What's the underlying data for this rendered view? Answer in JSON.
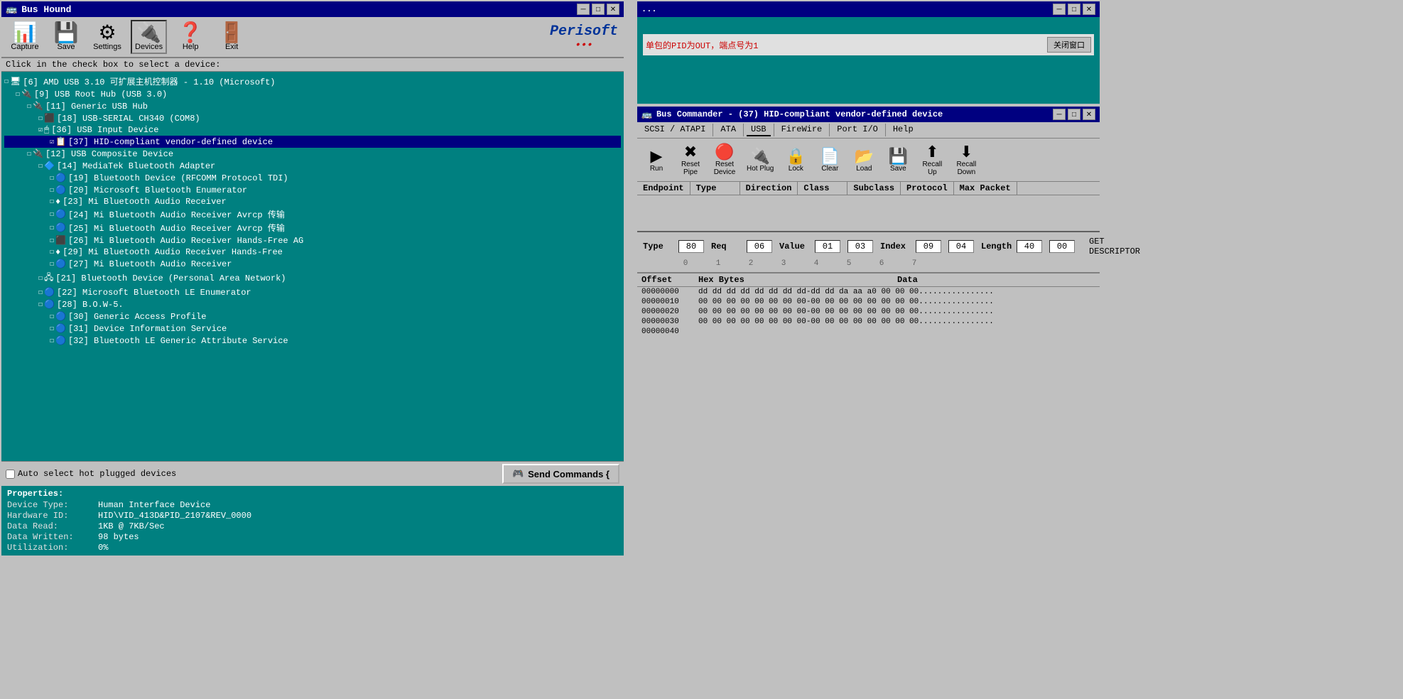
{
  "busHound": {
    "title": "Bus Hound",
    "hint": "Click in the check box to select a device:",
    "toolbar": {
      "capture_label": "Capture",
      "save_label": "Save",
      "settings_label": "Settings",
      "devices_label": "Devices",
      "help_label": "Help",
      "exit_label": "Exit"
    },
    "perisoft": {
      "name": "Perisoft",
      "dots": "•••"
    },
    "devices": [
      {
        "id": 1,
        "indent": 0,
        "checked": false,
        "icon": "🖥",
        "label": "[6] AMD USB 3.10 可扩展主机控制器 - 1.10 (Microsoft)",
        "selected": false
      },
      {
        "id": 2,
        "indent": 1,
        "checked": false,
        "icon": "🔌",
        "label": "[9] USB Root Hub (USB 3.0)",
        "selected": false
      },
      {
        "id": 3,
        "indent": 2,
        "checked": false,
        "icon": "🔌",
        "label": "[11] Generic USB Hub",
        "selected": false
      },
      {
        "id": 4,
        "indent": 3,
        "checked": false,
        "icon": "⬛",
        "label": "[18] USB-SERIAL CH340 (COM8)",
        "selected": false
      },
      {
        "id": 5,
        "indent": 3,
        "checked": true,
        "icon": "🖱",
        "label": "[36] USB Input Device",
        "selected": false
      },
      {
        "id": 6,
        "indent": 4,
        "checked": true,
        "icon": "📋",
        "label": "[37] HID-compliant vendor-defined device",
        "selected": true
      },
      {
        "id": 7,
        "indent": 2,
        "checked": false,
        "icon": "🔌",
        "label": "[12] USB Composite Device",
        "selected": false
      },
      {
        "id": 8,
        "indent": 3,
        "checked": false,
        "icon": "🔷",
        "label": "[14] MediaTek Bluetooth Adapter",
        "selected": false
      },
      {
        "id": 9,
        "indent": 4,
        "checked": false,
        "icon": "🔵",
        "label": "[19] Bluetooth Device (RFCOMM Protocol TDI)",
        "selected": false
      },
      {
        "id": 10,
        "indent": 4,
        "checked": false,
        "icon": "🔵",
        "label": "[20] Microsoft Bluetooth Enumerator",
        "selected": false
      },
      {
        "id": 11,
        "indent": 4,
        "checked": false,
        "icon": "♦",
        "label": "[23] Mi Bluetooth Audio Receiver",
        "selected": false
      },
      {
        "id": 12,
        "indent": 4,
        "checked": false,
        "icon": "🔵",
        "label": "[24] Mi Bluetooth Audio Receiver Avrcp 传输",
        "selected": false
      },
      {
        "id": 13,
        "indent": 4,
        "checked": false,
        "icon": "🔵",
        "label": "[25] Mi Bluetooth Audio Receiver Avrcp 传输",
        "selected": false
      },
      {
        "id": 14,
        "indent": 4,
        "checked": false,
        "icon": "⬛",
        "label": "[26] Mi Bluetooth Audio Receiver Hands-Free AG",
        "selected": false
      },
      {
        "id": 15,
        "indent": 4,
        "checked": false,
        "icon": "♦",
        "label": "[29] Mi Bluetooth Audio Receiver Hands-Free",
        "selected": false
      },
      {
        "id": 16,
        "indent": 4,
        "checked": false,
        "icon": "🔵",
        "label": "[27] Mi Bluetooth Audio Receiver",
        "selected": false
      },
      {
        "id": 17,
        "indent": 3,
        "checked": false,
        "icon": "🖧",
        "label": "[21] Bluetooth Device (Personal Area Network)",
        "selected": false
      },
      {
        "id": 18,
        "indent": 3,
        "checked": false,
        "icon": "🔵",
        "label": "[22] Microsoft Bluetooth LE Enumerator",
        "selected": false
      },
      {
        "id": 19,
        "indent": 3,
        "checked": false,
        "icon": "🔵",
        "label": "[28] B.O.W-5.",
        "selected": false
      },
      {
        "id": 20,
        "indent": 4,
        "checked": false,
        "icon": "🔵",
        "label": "[30] Generic Access Profile",
        "selected": false
      },
      {
        "id": 21,
        "indent": 4,
        "checked": false,
        "icon": "🔵",
        "label": "[31] Device Information Service",
        "selected": false
      },
      {
        "id": 22,
        "indent": 4,
        "checked": false,
        "icon": "🔵",
        "label": "[32] Bluetooth LE Generic Attribute Service",
        "selected": false
      }
    ],
    "autoSelect": "Auto select hot plugged devices",
    "sendCommands": "Send Commands {",
    "properties": {
      "title": "Properties:",
      "items": [
        {
          "label": "Device Type:",
          "value": "Human Interface Device"
        },
        {
          "label": "Hardware ID:",
          "value": "HID\\VID_413D&PID_2107&REV_0000"
        },
        {
          "label": "Data Read:",
          "value": "1KB @ 7KB/Sec"
        },
        {
          "label": "Data Written:",
          "value": "98 bytes"
        },
        {
          "label": "Utilization:",
          "value": "0%"
        }
      ]
    }
  },
  "busCommander": {
    "title": "Bus Commander - (37) HID-compliant vendor-defined device",
    "menus": [
      "SCSI / ATAPI",
      "ATA",
      "USB",
      "FireWire",
      "Port I/O",
      "Help"
    ],
    "activeMenu": "USB",
    "toolbar": {
      "run_label": "Run",
      "reset_pipe_label": "Reset\nPipe",
      "reset_device_label": "Reset\nDevice",
      "hot_plug_label": "Hot Plug",
      "lock_label": "Lock",
      "clear_label": "Clear",
      "load_label": "Load",
      "save_label": "Save",
      "recall_up_label": "Recall\nUp",
      "recall_down_label": "Recall\nDown"
    },
    "tabs": [
      "Endpoint",
      "Type",
      "Direction",
      "Class",
      "Subclass",
      "Protocol",
      "Max Packet"
    ],
    "command": {
      "type_label": "Type",
      "req_label": "Req",
      "value_label": "Value",
      "index_label": "Index",
      "length_label": "Length",
      "type_val": "80",
      "req_val": "06",
      "value_val1": "01",
      "value_val2": "03",
      "index_val1": "09",
      "index_val2": "04",
      "length_val1": "40",
      "length_val2": "00",
      "description": "GET DESCRIPTOR",
      "indices": [
        "0",
        "1",
        "2",
        "3",
        "4",
        "5",
        "6",
        "7"
      ]
    },
    "dataSection": {
      "offset_header": "Offset",
      "hex_header": "Hex Bytes",
      "data_header": "Data",
      "rows": [
        {
          "offset": "00000000",
          "hex": "dd dd dd dd dd dd dd dd-dd dd da aa a0 00 00 00",
          "data": "................"
        },
        {
          "offset": "00000010",
          "hex": "00 00 00 00 00 00 00 00-00 00 00 00 00 00 00 00",
          "data": "................"
        },
        {
          "offset": "00000020",
          "hex": "00 00 00 00 00 00 00 00-00 00 00 00 00 00 00 00",
          "data": "................"
        },
        {
          "offset": "00000030",
          "hex": "00 00 00 00 00 00 00 00-00 00 00 00 00 00 00 00",
          "data": "................"
        },
        {
          "offset": "00000040",
          "hex": "",
          "data": ""
        }
      ]
    }
  },
  "bgWindow": {
    "text": "单包的PID为OUT，端点号为1"
  }
}
